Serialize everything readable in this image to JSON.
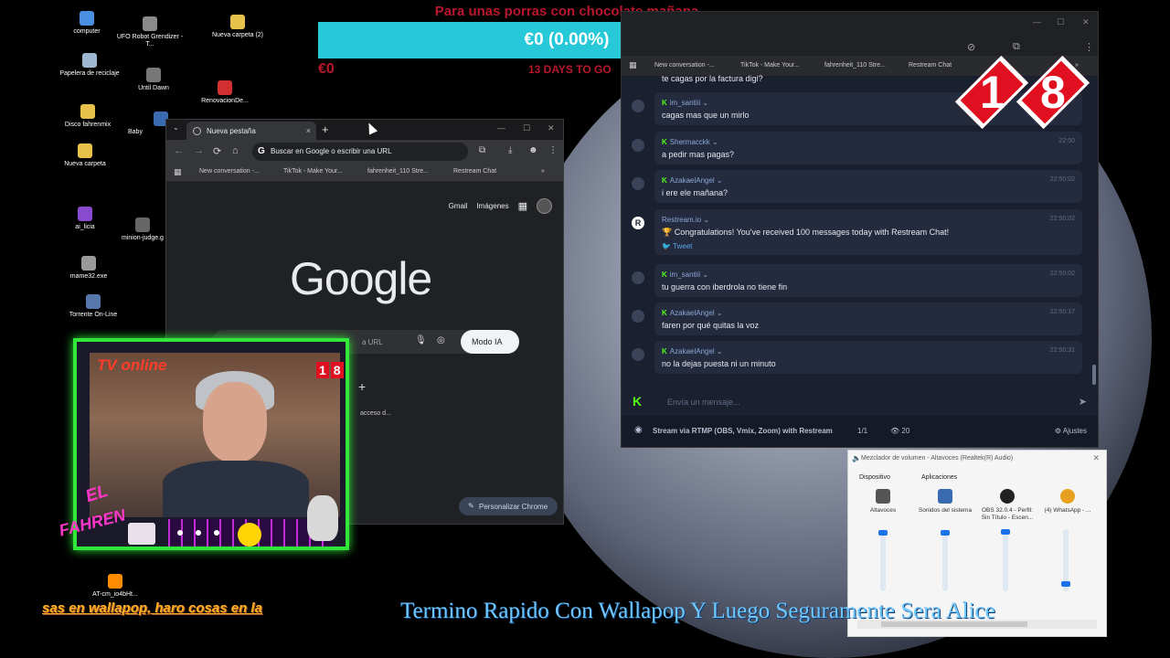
{
  "desktop": {
    "icons": [
      {
        "label": "computer",
        "color": "#4a90e2"
      },
      {
        "label": "UFO Robot Grendizer - T...",
        "color": "#8a8a8a"
      },
      {
        "label": "Nueva carpeta (2)",
        "color": "#e8c14a"
      },
      {
        "label": "Papelera de reciclaje",
        "color": "#9db8d0"
      },
      {
        "label": "Until Dawn",
        "color": "#777777"
      },
      {
        "label": "RenovacionDe...",
        "color": "#d03030"
      },
      {
        "label": "Disco fahrenmix",
        "color": "#e8c14a"
      },
      {
        "label": "Baby",
        "color": "#3a6bb0"
      },
      {
        "label": "Nueva carpeta",
        "color": "#e8c14a"
      },
      {
        "label": "ai_licia",
        "color": "#8a4ad0"
      },
      {
        "label": "minion-judge.g",
        "color": "#666666"
      },
      {
        "label": "mame32.exe",
        "color": "#999999"
      },
      {
        "label": "Torrente On-Line",
        "color": "#5577aa"
      },
      {
        "label": "AT-cm_io4bHt...",
        "color": "#ff8c00"
      }
    ]
  },
  "donation": {
    "title": "Para unas porras con chocolate mañana",
    "amount": "€0 (0.00%)",
    "raised": "€0",
    "days_left": "13 DAYS TO GO",
    "progress": 0
  },
  "chrome": {
    "tab_title": "Nueva pestaña",
    "tab_close": "×",
    "new_tab": "+",
    "tab_search": "⌄",
    "minimize": "—",
    "maximize": "☐",
    "close": "✕",
    "back": "←",
    "forward": "→",
    "reload": "⟳",
    "home": "⌂",
    "omnibox_placeholder": "Buscar en Google o escribir una URL",
    "bookmarks": [
      "New conversation -...",
      "TikTok - Make Your...",
      "fahrenheit_110 Stre...",
      "Restream Chat"
    ],
    "bookmarks_more": "»",
    "gmail": "Gmail",
    "images": "Imágenes",
    "logo": "Google",
    "search_placeholder": "a URL",
    "modo_ia": "Modo IA",
    "shortcut_add": "+",
    "shortcut_label": "acceso d...",
    "personalize": "Personalizar Chrome"
  },
  "restream": {
    "window_controls": [
      "—",
      "☐",
      "✕"
    ],
    "bookmarks": [
      "New conversation -...",
      "TikTok - Make Your...",
      "fahrenheit_110 Stre...",
      "Restream Chat"
    ],
    "bookmarks_more": "»",
    "truncated_message": "te cagas por la factura digi?",
    "messages": [
      {
        "user": "im_santiii",
        "time": "",
        "text": "cagas mas que un mirlo",
        "platform": "kick"
      },
      {
        "user": "Shermacckk",
        "time": "22:50",
        "text": "a pedir mas pagas?",
        "platform": "kick"
      },
      {
        "user": "AzakaelAngel",
        "time": "22:50:02",
        "text": "i ere ele mañana?",
        "platform": "kick"
      },
      {
        "user": "Restream.io",
        "time": "22:50:02",
        "text": "🏆 Congratulations! You've received 100 messages today with Restream Chat!",
        "tweet": "Tweet",
        "platform": "restream"
      },
      {
        "user": "im_santiii",
        "time": "22:50:02",
        "text": "tu guerra con iberdrola no tiene fin",
        "platform": "kick"
      },
      {
        "user": "AzakaelAngel",
        "time": "22:50:17",
        "text": "faren por qué quitas la voz",
        "platform": "kick"
      },
      {
        "user": "AzakaelAngel",
        "time": "22:50:31",
        "text": "no la dejas puesta ni un minuto",
        "platform": "kick"
      }
    ],
    "input_placeholder": "Envía un mensaje...",
    "send": "➤",
    "footer_stream": "Stream via RTMP (OBS, Vmix, Zoom) with Restream",
    "footer_count": "1/1",
    "footer_viewers": "20",
    "footer_settings": "Ajustes"
  },
  "badge": {
    "digit1": "1",
    "digit2": "8"
  },
  "webcam": {
    "tv_label": "TV online",
    "el": "EL",
    "fahren": "FAHREN",
    "mini_1": "1",
    "mini_8": "8"
  },
  "mixer": {
    "title": "Mezclador de volumen - Altavoces (Realtek(R) Audio)",
    "close": "✕",
    "device_header": "Dispositivo",
    "apps_header": "Aplicaciones",
    "channels": [
      {
        "label": "Altavoces",
        "level": 0.98,
        "color": "#555555"
      },
      {
        "label": "Sonidos del sistema",
        "level": 0.98,
        "color": "#3a6bb0"
      },
      {
        "label": "OBS 32.0.4 - Perfil: Sin Título - Escen...",
        "level": 1.0,
        "color": "#222222"
      },
      {
        "label": "(4) WhatsApp - ...",
        "level": 0.08,
        "color": "#e8a020"
      }
    ]
  },
  "ticker": {
    "left": "sas en wallapop, haro cosas en la",
    "right": "Termino Rapido Con Wallapop Y Luego Seguramente Sera Alice"
  }
}
